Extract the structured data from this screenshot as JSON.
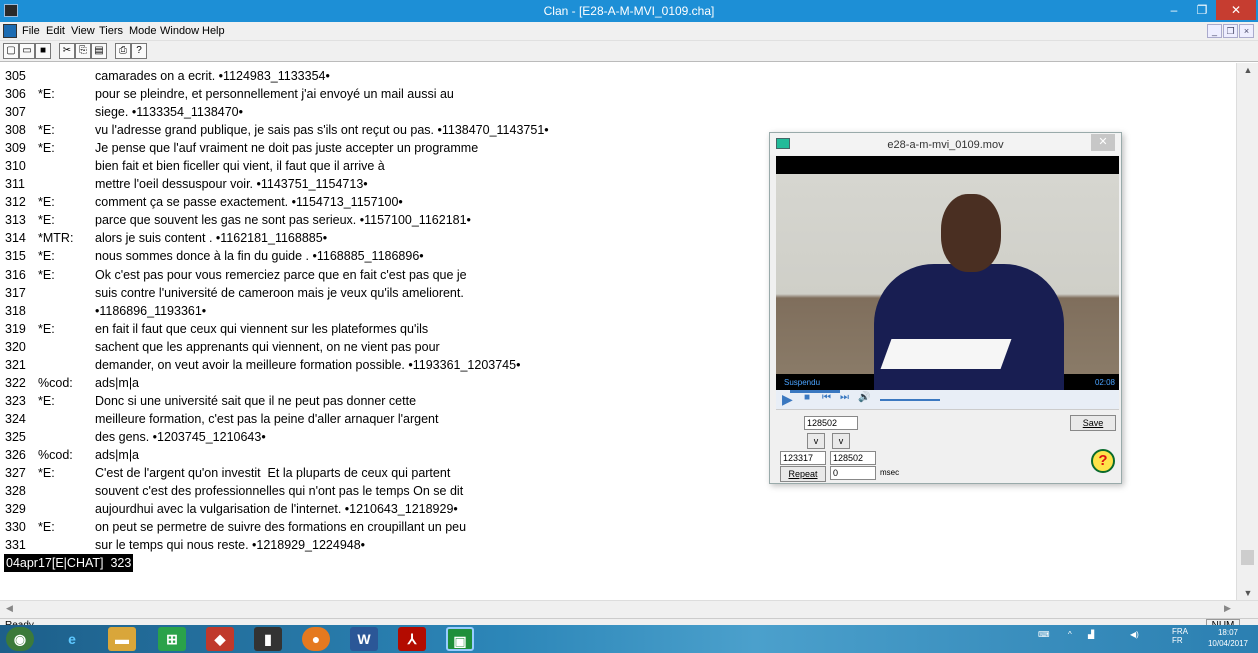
{
  "window": {
    "title": "Clan - [E28-A-M-MVI_0109.cha]"
  },
  "menu": [
    "File",
    "Edit",
    "View",
    "Tiers",
    "Mode",
    "Window",
    "Help"
  ],
  "toolbar_icons": [
    "new-icon",
    "open-icon",
    "save-icon",
    "cut-icon",
    "copy-icon",
    "paste-icon",
    "print-icon",
    "help-icon"
  ],
  "transcript": [
    {
      "n": "305",
      "s": "",
      "t": "camarades on a ecrit. •1124983_1133354•"
    },
    {
      "n": "306",
      "s": "*E:",
      "t": "pour se pleindre, et personnellement j'ai envoyé un mail aussi au"
    },
    {
      "n": "307",
      "s": "",
      "t": "siege. •1133354_1138470•"
    },
    {
      "n": "308",
      "s": "*E:",
      "t": "vu l'adresse grand publique, je sais pas s'ils ont reçut ou pas. •1138470_1143751•"
    },
    {
      "n": "309",
      "s": "*E:",
      "t": "Je pense que l'auf vraiment ne doit pas juste accepter un programme"
    },
    {
      "n": "310",
      "s": "",
      "t": "bien fait et bien ficeller qui vient, il faut que il arrive à"
    },
    {
      "n": "311",
      "s": "",
      "t": "mettre l'oeil dessuspour voir. •1143751_1154713•"
    },
    {
      "n": "312",
      "s": "*E:",
      "t": "comment ça se passe exactement. •1154713_1157100•"
    },
    {
      "n": "313",
      "s": "*E:",
      "t": "parce que souvent les gas ne sont pas serieux. •1157100_1162181•"
    },
    {
      "n": "314",
      "s": "*MTR:",
      "t": "alors je suis content . •1162181_1168885•"
    },
    {
      "n": "315",
      "s": "*E:",
      "t": "nous sommes donce à la fin du guide . •1168885_1186896•"
    },
    {
      "n": "316",
      "s": "*E:",
      "t": "Ok c'est pas pour vous remerciez parce que en fait c'est pas que je"
    },
    {
      "n": "317",
      "s": "",
      "t": "suis contre l'université de cameroon mais je veux qu'ils ameliorent."
    },
    {
      "n": "318",
      "s": "",
      "t": "•1186896_1193361•"
    },
    {
      "n": "319",
      "s": "*E:",
      "t": "en fait il faut que ceux qui viennent sur les plateformes qu'ils"
    },
    {
      "n": "320",
      "s": "",
      "t": "sachent que les apprenants qui viennent, on ne vient pas pour"
    },
    {
      "n": "321",
      "s": "",
      "t": "demander, on veut avoir la meilleure formation possible. •1193361_1203745•"
    },
    {
      "n": "322",
      "s": "%cod:",
      "t": "ads|m|a"
    },
    {
      "n": "323",
      "s": "*E:",
      "t": "Donc si une université sait que il ne peut pas donner cette"
    },
    {
      "n": "324",
      "s": "",
      "t": "meilleure formation, c'est pas la peine d'aller arnaquer l'argent"
    },
    {
      "n": "325",
      "s": "",
      "t": "des gens. •1203745_1210643•"
    },
    {
      "n": "326",
      "s": "%cod:",
      "t": "ads|m|a"
    },
    {
      "n": "327",
      "s": "*E:",
      "t": "C'est de l'argent qu'on investit  Et la pluparts de ceux qui partent"
    },
    {
      "n": "328",
      "s": "",
      "t": "souvent c'est des professionnelles qui n'ont pas le temps On se dit"
    },
    {
      "n": "329",
      "s": "",
      "t": "aujourdhui avec la vulgarisation de l'internet. •1210643_1218929•"
    },
    {
      "n": "330",
      "s": "*E:",
      "t": "on peut se permetre de suivre des formations en croupillant un peu"
    },
    {
      "n": "331",
      "s": "",
      "t": "sur le temps qui nous reste. •1218929_1224948•"
    }
  ],
  "edit_status_line": "04apr17[E|CHAT]  323",
  "status": {
    "ready": "Ready",
    "num": "NUM"
  },
  "video_window": {
    "title": "e28-a-m-mvi_0109.mov",
    "state": "Suspendu",
    "time": "02:08",
    "current_value": "128502",
    "save_label": "Save",
    "v_label": "v",
    "start_value": "123317",
    "end_value": "128502",
    "repeat_label": "Repeat",
    "repeat_value": "0",
    "msec_label": "msec",
    "help_glyph": "?"
  },
  "taskbar": {
    "lang": "FRA",
    "lang2": "FR",
    "time": "18:07",
    "date": "10/04/2017"
  }
}
